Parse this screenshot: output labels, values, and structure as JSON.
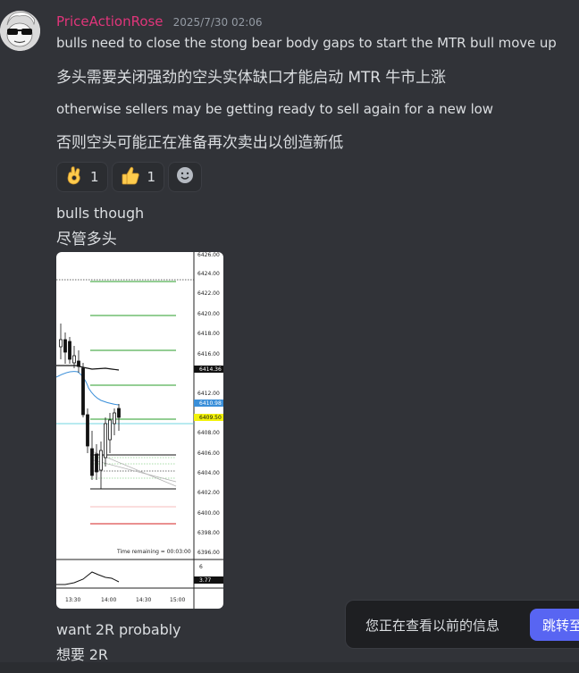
{
  "message": {
    "author": "PriceActionRose",
    "timestamp": "2025/7/30 02:06",
    "lines": [
      "bulls need to close the stong bear body gaps to start the MTR bull move up",
      "多头需要关闭强劲的空头实体缺口才能启动 MTR 牛市上涨",
      "otherwise sellers may be getting ready to sell again for a new low",
      "否则空头可能正在准备再次卖出以创造新低"
    ],
    "reactions": [
      {
        "emoji": "ok-hand",
        "count": "1"
      },
      {
        "emoji": "thumbs-up",
        "count": "1"
      }
    ]
  },
  "followups": {
    "line1": "bulls though",
    "line2": "尽管多头",
    "line3": "want 2R probably",
    "line4": "想要 2R"
  },
  "chart": {
    "price_labels": [
      "6426.00",
      "6424.00",
      "6422.00",
      "6420.00",
      "6418.00",
      "6416.00",
      "6414.36",
      "6412.00",
      "6410.98",
      "6409.50",
      "6408.00",
      "6406.00",
      "6404.00",
      "6402.00",
      "6400.00",
      "6398.00",
      "6396.00"
    ],
    "time_remaining": "Time remaining = 00:03:00",
    "x_labels": [
      "13:30",
      "14:00",
      "14:30",
      "15:00"
    ],
    "indicator_labels": [
      "6",
      "3.77"
    ]
  },
  "toast": {
    "text": "您正在查看以前的信息",
    "button": "跳转至"
  }
}
